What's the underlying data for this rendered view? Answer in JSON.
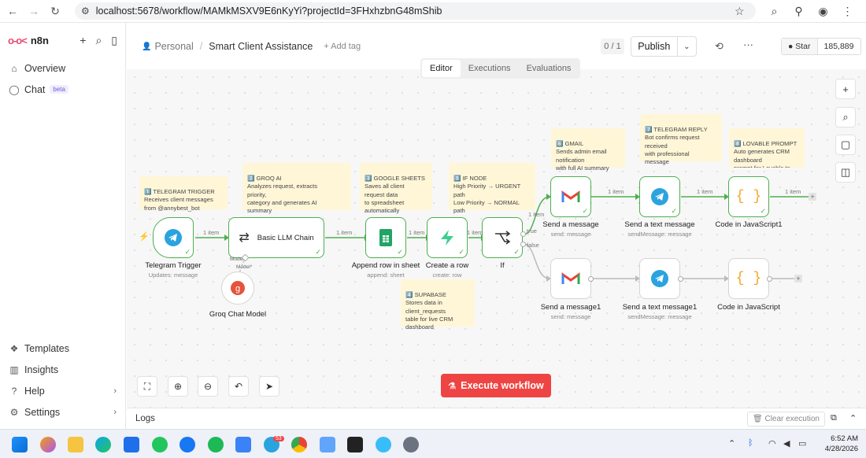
{
  "browser": {
    "url": "localhost:5678/workflow/MAMkMSXV9E6nKyYi?projectId=3FHxhzbnG48mShib"
  },
  "sidebar": {
    "logo": "n8n",
    "items": [
      {
        "label": "Overview",
        "icon": "home-icon"
      },
      {
        "label": "Chat",
        "icon": "chat-icon",
        "badge": "beta"
      }
    ],
    "bottom": [
      {
        "label": "Templates",
        "icon": "templates-icon"
      },
      {
        "label": "Insights",
        "icon": "insights-icon"
      },
      {
        "label": "Help",
        "icon": "help-icon"
      },
      {
        "label": "Settings",
        "icon": "settings-icon"
      }
    ]
  },
  "header": {
    "project": "Personal",
    "workflow_name": "Smart Client Assistance",
    "add_tag": "+ Add tag",
    "counter": "0 / 1",
    "publish": "Publish",
    "star": "Star",
    "star_count": "185,889"
  },
  "tabs": [
    "Editor",
    "Executions",
    "Evaluations"
  ],
  "notes": [
    {
      "title": "1️⃣ TELEGRAM TRIGGER",
      "body": "Receives client messages\nfrom @annybest_bot"
    },
    {
      "title": "2️⃣ GROQ AI",
      "body": "Analyzes request, extracts\npriority,\ncategory and generates AI\nsummary"
    },
    {
      "title": "3️⃣ GOOGLE SHEETS",
      "body": "Saves all client\nrequest data\nto spreadsheet\nautomatically"
    },
    {
      "title": "5️⃣ IF NODE",
      "body": "High Priority → URGENT\npath\nLow Priority → NORMAL\npath"
    },
    {
      "title": "6️⃣ GMAIL",
      "body": "Sends admin email\nnotification\nwith full AI summary"
    },
    {
      "title": "7️⃣ TELEGRAM REPLY",
      "body": "Bot confirms request\nreceived\nwith professional\nmessage"
    },
    {
      "title": "8️⃣ LOVABLE PROMPT",
      "body": "Auto generates CRM\ndashboard\nprompt for Lovable to\nbuild"
    },
    {
      "title": "4️⃣ SUPABASE",
      "body": "Stores data in\nclient_requests\ntable for live CRM\ndashboard"
    }
  ],
  "nodes": {
    "telegram_trigger": {
      "label": "Telegram Trigger",
      "sub": "Updates: message"
    },
    "llm_chain": {
      "label": "Basic LLM Chain",
      "port": "Model",
      "port_required": "Model*"
    },
    "groq": {
      "label": "Groq Chat Model"
    },
    "append_row": {
      "label": "Append row in sheet",
      "sub": "append: sheet"
    },
    "create_row": {
      "label": "Create a row",
      "sub": "create: row"
    },
    "if_node": {
      "label": "If",
      "true": "true",
      "false": "false"
    },
    "send_msg": {
      "label": "Send a message",
      "sub": "send: message"
    },
    "send_text": {
      "label": "Send a text message",
      "sub": "sendMessage: message"
    },
    "code1": {
      "label": "Code in JavaScript1"
    },
    "send_msg1": {
      "label": "Send a message1",
      "sub": "send: message"
    },
    "send_text1": {
      "label": "Send a text message1",
      "sub": "sendMessage: message"
    },
    "code": {
      "label": "Code in JavaScript"
    }
  },
  "edge_label": "1 item",
  "execute": "Execute workflow",
  "logs": {
    "title": "Logs",
    "clear": "Clear execution"
  },
  "taskbar": {
    "time": "6:52 AM",
    "date": "4/28/2026",
    "telegram_badge": "53"
  },
  "colors": {
    "success": "#4caf50",
    "execute": "#ef4444",
    "brand": "#ea4b71",
    "note": "#fff6d8"
  }
}
